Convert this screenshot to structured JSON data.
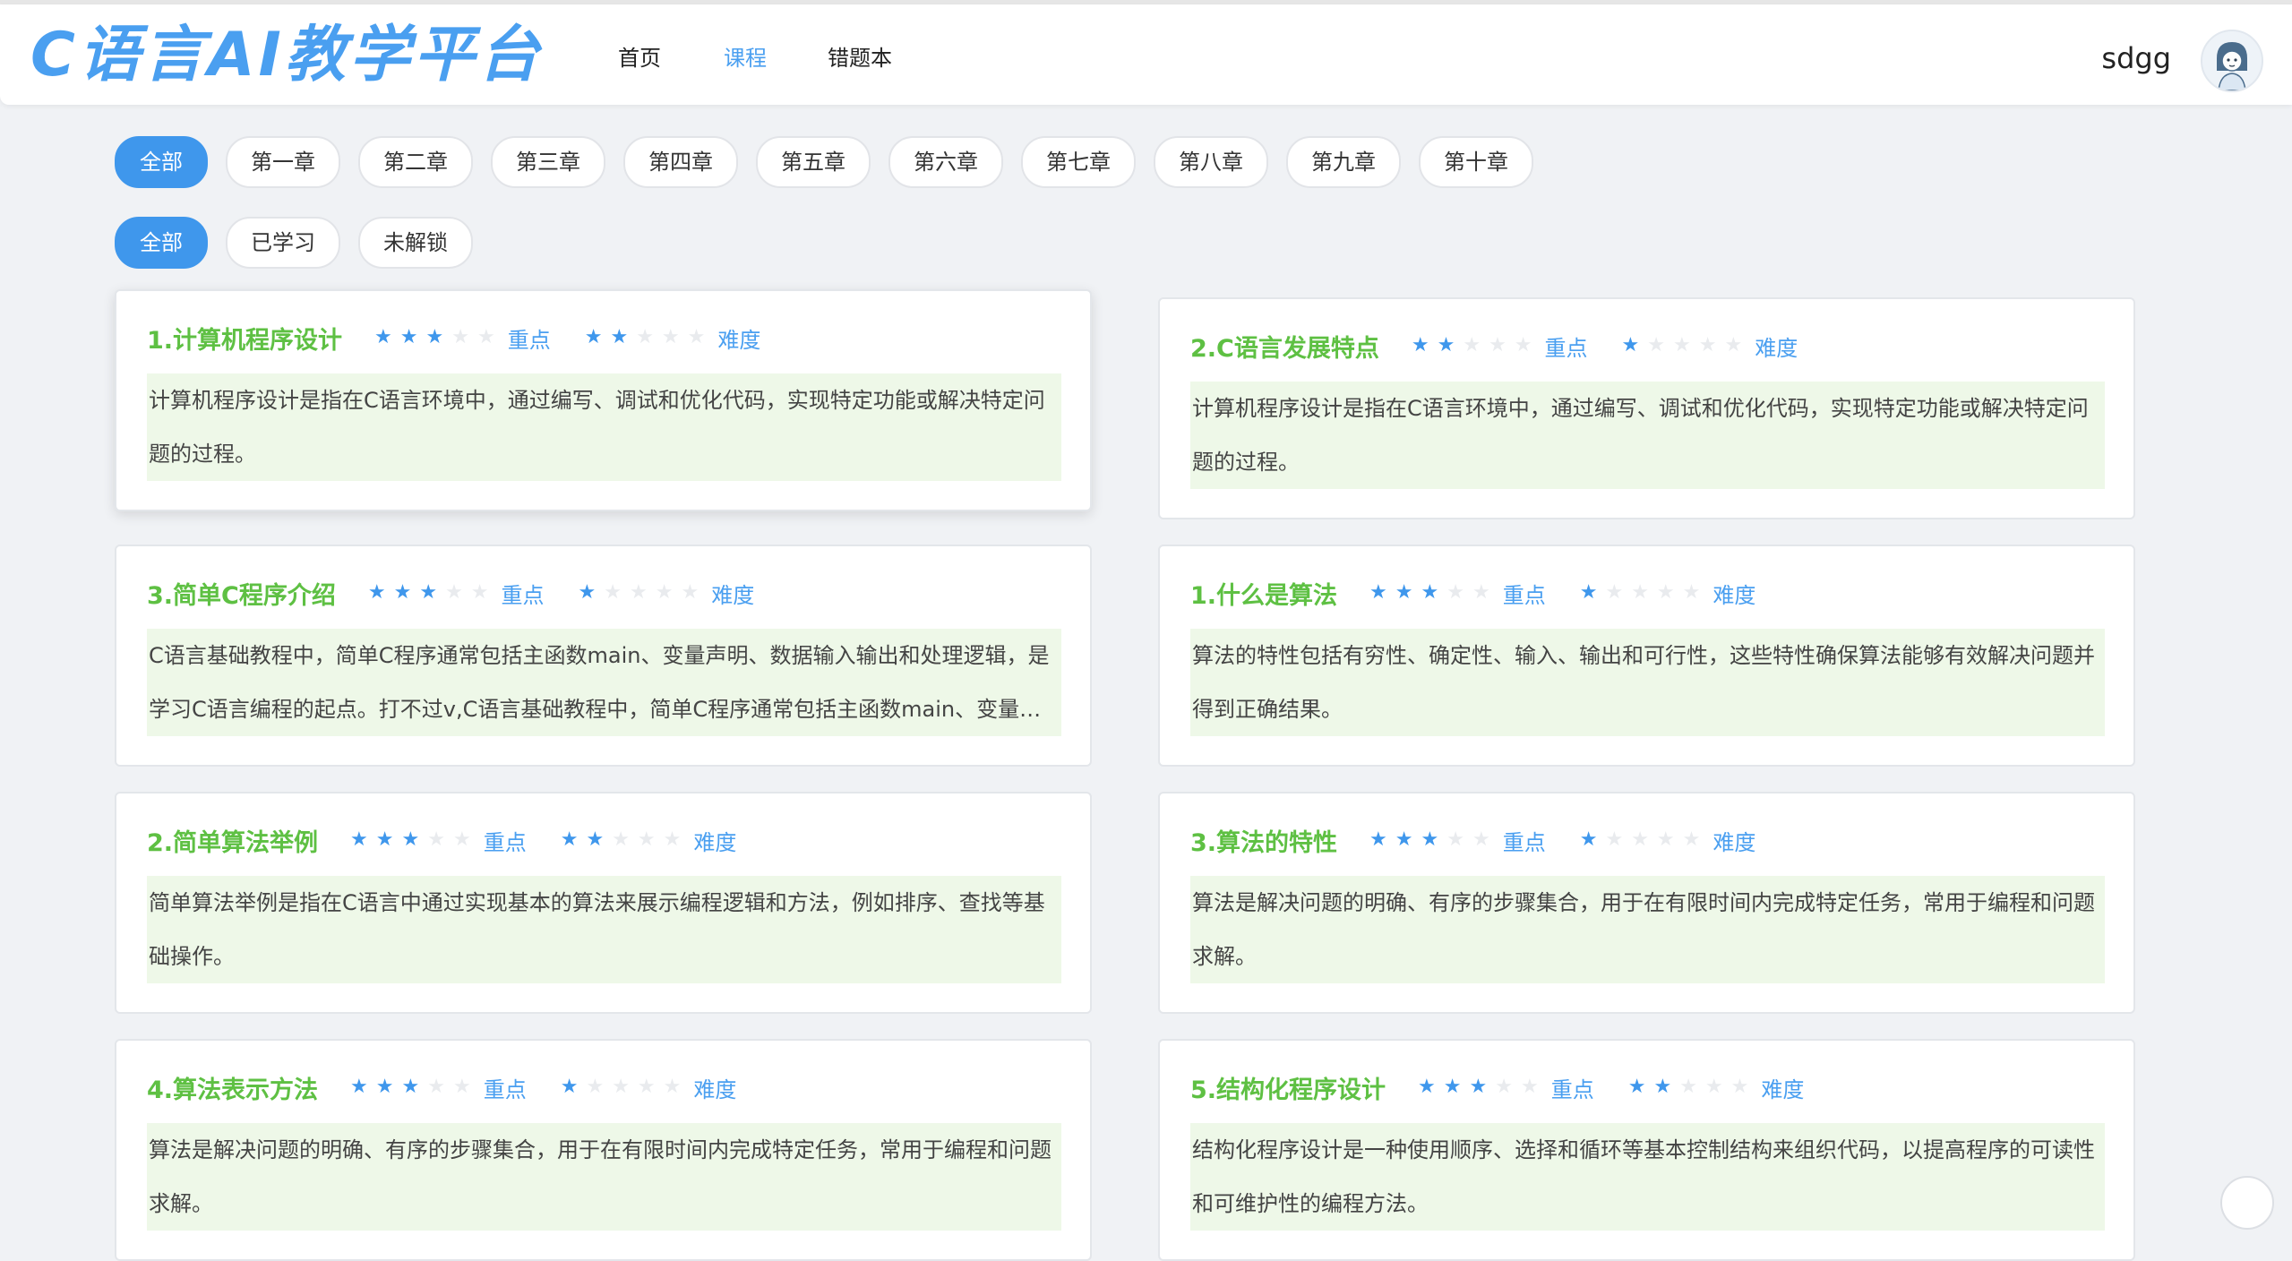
{
  "app": {
    "logo": "C语言AI教学平台",
    "nav": [
      "首页",
      "课程",
      "错题本"
    ],
    "active_nav": 1,
    "username": "sdgg"
  },
  "chapter_filters": [
    "全部",
    "第一章",
    "第二章",
    "第三章",
    "第四章",
    "第五章",
    "第六章",
    "第七章",
    "第八章",
    "第九章",
    "第十章"
  ],
  "status_filters": [
    "全部",
    "已学习",
    "未解锁"
  ],
  "labels": {
    "importance": "重点",
    "difficulty": "难度"
  },
  "courses": [
    {
      "title": "1.计算机程序设计",
      "importance": 3,
      "difficulty": 2,
      "desc": "计算机程序设计是指在C语言环境中，通过编写、调试和优化代码，实现特定功能或解决特定问题的过程。"
    },
    {
      "title": "2.C语言发展特点",
      "importance": 2,
      "difficulty": 1,
      "desc": "计算机程序设计是指在C语言环境中，通过编写、调试和优化代码，实现特定功能或解决特定问题的过程。"
    },
    {
      "title": "3.简单C程序介绍",
      "importance": 3,
      "difficulty": 1,
      "desc": "C语言基础教程中，简单C程序通常包括主函数main、变量声明、数据输入输出和处理逻辑，是学习C语言编程的起点。打不过v,C语言基础教程中，简单C程序通常包括主函数main、变量声明、数据输入输出和处理逻辑"
    },
    {
      "title": "1.什么是算法",
      "importance": 3,
      "difficulty": 1,
      "desc": "算法的特性包括有穷性、确定性、输入、输出和可行性，这些特性确保算法能够有效解决问题并得到正确结果。"
    },
    {
      "title": "2.简单算法举例",
      "importance": 3,
      "difficulty": 2,
      "desc": "简单算法举例是指在C语言中通过实现基本的算法来展示编程逻辑和方法，例如排序、查找等基础操作。"
    },
    {
      "title": "3.算法的特性",
      "importance": 3,
      "difficulty": 1,
      "desc": "算法是解决问题的明确、有序的步骤集合，用于在有限时间内完成特定任务，常用于编程和问题求解。"
    },
    {
      "title": "4.算法表示方法",
      "importance": 3,
      "difficulty": 1,
      "desc": "算法是解决问题的明确、有序的步骤集合，用于在有限时间内完成特定任务，常用于编程和问题求解。"
    },
    {
      "title": "5.结构化程序设计",
      "importance": 3,
      "difficulty": 2,
      "desc": "结构化程序设计是一种使用顺序、选择和循环等基本控制结构来组织代码，以提高程序的可读性和可维护性的编程方法。"
    }
  ]
}
